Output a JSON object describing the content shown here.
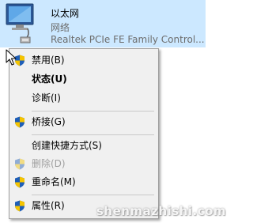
{
  "adapter": {
    "name": "以太网",
    "status": "网络",
    "device": "Realtek PCIe FE Family Control..."
  },
  "menu": {
    "items": [
      {
        "label": "禁用(B)",
        "shield": true,
        "bold": false,
        "disabled": false
      },
      {
        "label": "状态(U)",
        "shield": false,
        "bold": true,
        "disabled": false
      },
      {
        "label": "诊断(I)",
        "shield": false,
        "bold": false,
        "disabled": false
      },
      {
        "label": "桥接(G)",
        "shield": true,
        "bold": false,
        "disabled": false
      },
      {
        "label": "创建快捷方式(S)",
        "shield": false,
        "bold": false,
        "disabled": false
      },
      {
        "label": "删除(D)",
        "shield": true,
        "bold": false,
        "disabled": true
      },
      {
        "label": "重命名(M)",
        "shield": true,
        "bold": false,
        "disabled": false
      },
      {
        "label": "属性(R)",
        "shield": true,
        "bold": false,
        "disabled": false
      }
    ]
  },
  "icons": {
    "adapter": "network-adapter-icon",
    "shield": "uac-shield-icon",
    "cursor": "mouse-cursor-icon"
  },
  "colors": {
    "selection": "#cce8ff",
    "menu_background": "#f0f0f0",
    "disabled_text": "#a0a0a0",
    "shield_blue": "#1e5eb8",
    "shield_yellow": "#f5c400"
  },
  "watermark": "shenmazhishi.com"
}
